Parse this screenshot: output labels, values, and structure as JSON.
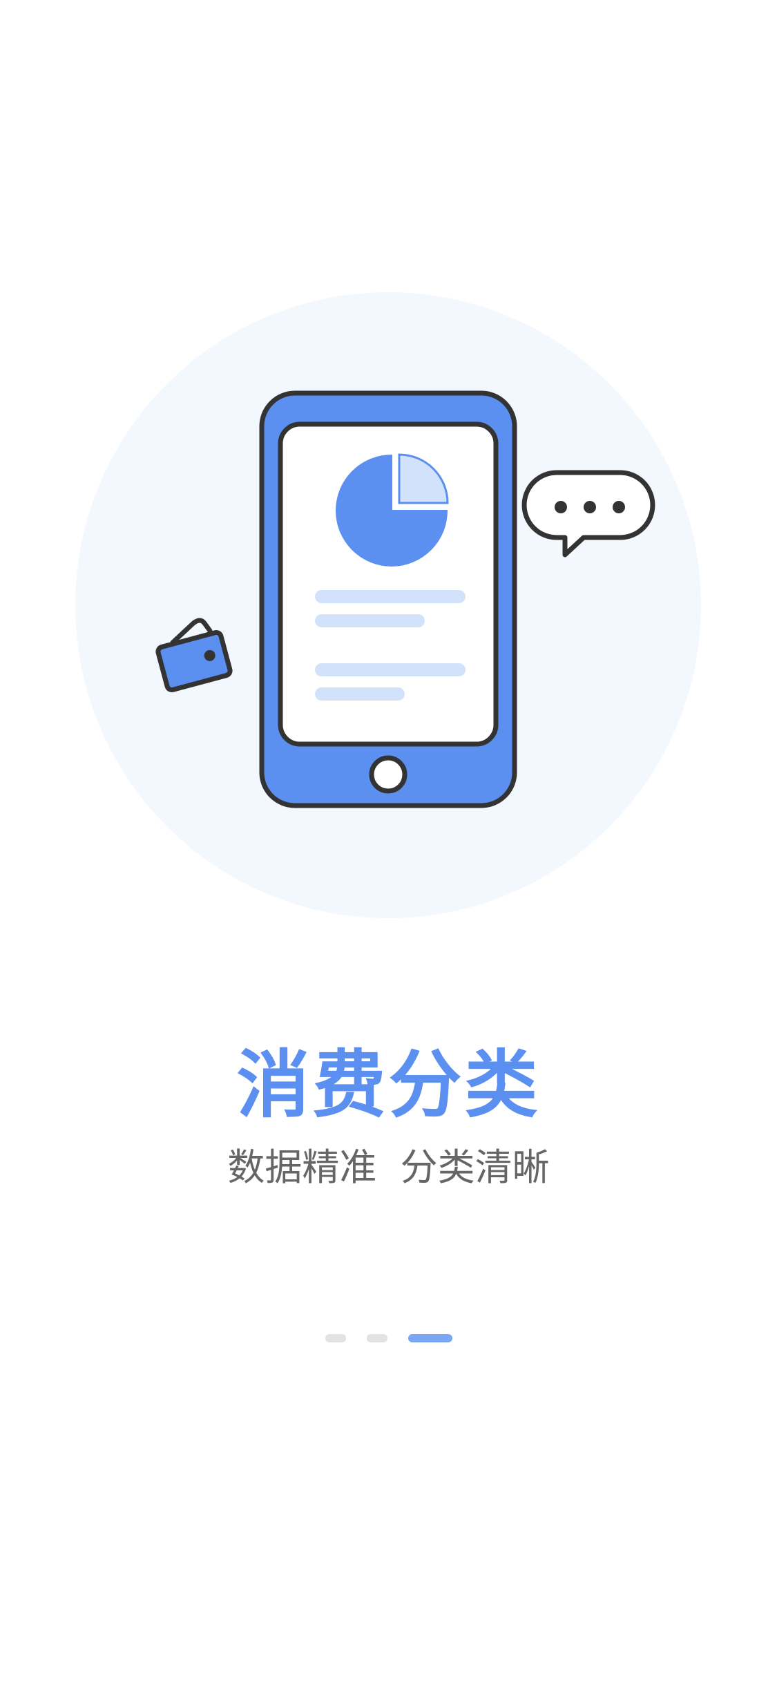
{
  "onboarding": {
    "title": "消费分类",
    "subtitle": "数据精准  分类清晰"
  },
  "pager": {
    "total": 3,
    "active_index": 2
  },
  "colors": {
    "accent": "#5b8ff0",
    "accent_light": "#d3e2fb",
    "circle_bg": "#f3f7fe",
    "outline": "#333333",
    "subtitle": "#666666",
    "dot_inactive": "#e2e2e2",
    "dot_active": "#7aa6f3"
  },
  "icons": {
    "phone": "phone-icon",
    "pie_chart": "pie-chart-icon",
    "wallet": "wallet-icon",
    "chat_bubble": "chat-bubble-icon"
  }
}
